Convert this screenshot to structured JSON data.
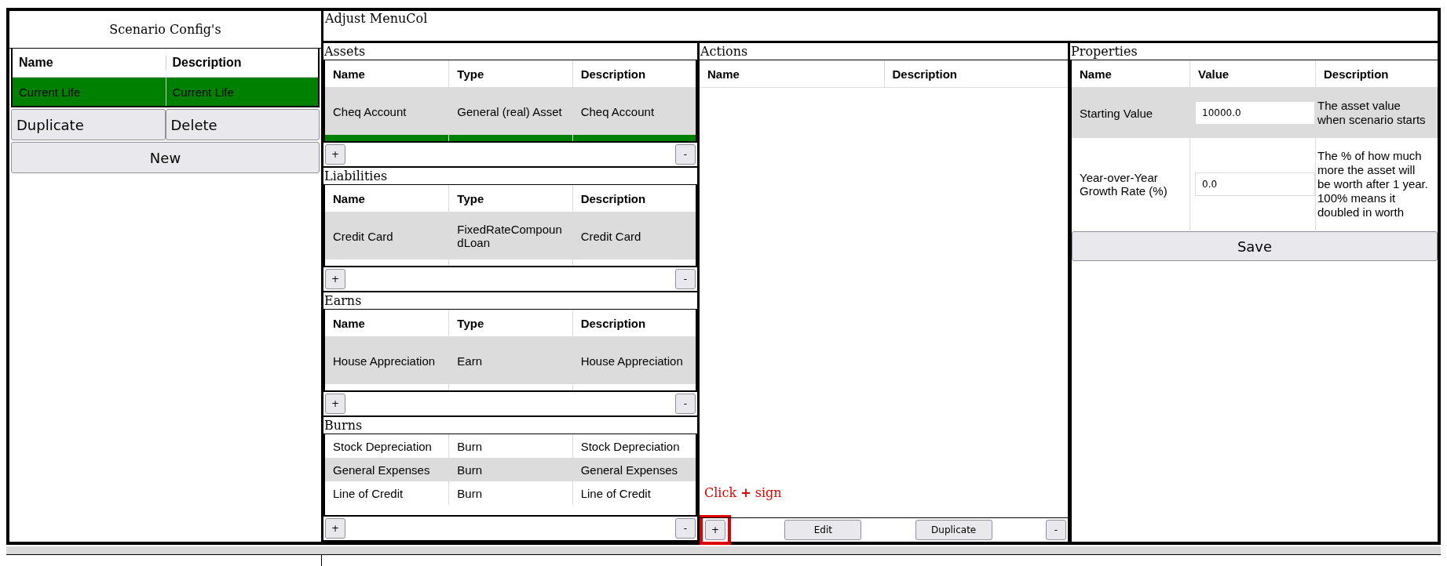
{
  "sidebar": {
    "title": "Scenario Config's",
    "columns": [
      "Name",
      "Description"
    ],
    "rows": [
      {
        "name": "Current Life",
        "description": "Current Life",
        "selected": true
      }
    ],
    "buttons": [
      "Duplicate",
      "Delete"
    ],
    "new_button": "New"
  },
  "editor": {
    "title": "Adjust MenuCol",
    "sections": [
      {
        "title": "Assets",
        "columns": [
          "Name",
          "Type",
          "Description"
        ],
        "rows": [
          {
            "cells": [
              "Cheq Account",
              "General (real) Asset",
              "Cheq Account"
            ],
            "selected": false,
            "shaded": true
          },
          {
            "selected": true,
            "shaded": false
          }
        ],
        "add": "+",
        "remove": "-"
      },
      {
        "title": "Liabilities",
        "columns": [
          "Name",
          "Type",
          "Description"
        ],
        "rows": [
          {
            "cells": [
              "Credit Card",
              "FixedRateCompoundLoan",
              "Credit Card"
            ],
            "selected": false,
            "shaded": true
          },
          {
            "selected": false,
            "shaded": false
          }
        ],
        "add": "+",
        "remove": "-"
      },
      {
        "title": "Earns",
        "columns": [
          "Name",
          "Type",
          "Description"
        ],
        "rows": [
          {
            "cells": [
              "House Appreciation",
              "Earn",
              "House Appreciation"
            ],
            "selected": false,
            "shaded": true
          },
          {
            "selected": false,
            "shaded": false
          }
        ],
        "add": "+",
        "remove": "-"
      },
      {
        "title": "Burns",
        "rows": [
          {
            "cells": [
              "Stock Depreciation",
              "Burn",
              "Stock Depreciation"
            ],
            "selected": false,
            "shaded": false
          },
          {
            "cells": [
              "General Expenses",
              "Burn",
              "General Expenses"
            ],
            "selected": false,
            "shaded": true
          },
          {
            "cells": [
              "Line of Credit",
              "Burn",
              "Line of Credit"
            ],
            "selected": false,
            "shaded": false
          }
        ],
        "add": "+",
        "remove": "-"
      }
    ],
    "actions": {
      "title": "Actions",
      "columns": [
        "Name",
        "Description"
      ],
      "buttons": [
        {
          "label": "+",
          "kind": "small",
          "highlighted": true
        },
        {
          "label": "Edit",
          "kind": "wide",
          "highlighted": false
        },
        {
          "label": "Duplicate",
          "kind": "wide",
          "highlighted": false
        },
        {
          "label": "-",
          "kind": "small",
          "highlighted": false
        }
      ]
    },
    "properties": {
      "title": "Properties",
      "columns": [
        "Name",
        "Value",
        "Description"
      ],
      "rows": [
        {
          "name": "Starting Value",
          "value": "10000.0",
          "description": "The asset value when scenario starts",
          "shaded": true
        },
        {
          "name": "Year-over-Year Growth Rate (%)",
          "value": "0.0",
          "description": "The % of how much more the asset will be worth after 1 year. 100% means it doubled in worth",
          "shaded": false
        }
      ],
      "save_button": "Save"
    }
  },
  "annotation": "Click **+** sign"
}
